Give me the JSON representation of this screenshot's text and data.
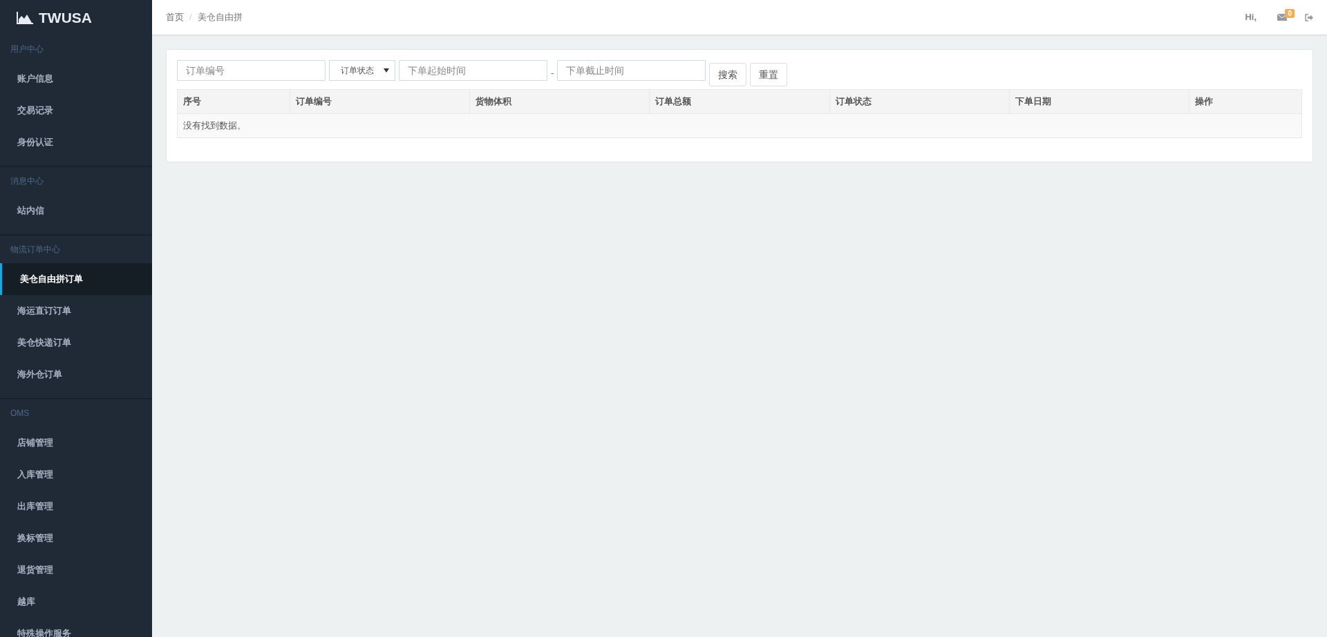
{
  "brand": {
    "name": "TWUSA"
  },
  "sidebar": {
    "sections": [
      {
        "title": "用户中心",
        "items": [
          {
            "label": "账户信息",
            "selected": false
          },
          {
            "label": "交易记录",
            "selected": false
          },
          {
            "label": "身份认证",
            "selected": false
          }
        ]
      },
      {
        "title": "消息中心",
        "items": [
          {
            "label": "站内信",
            "selected": false
          }
        ]
      },
      {
        "title": "物流订单中心",
        "items": [
          {
            "label": "美仓自由拼订单",
            "selected": true
          },
          {
            "label": "海运直订订单",
            "selected": false
          },
          {
            "label": "美仓快递订单",
            "selected": false
          },
          {
            "label": "海外仓订单",
            "selected": false
          }
        ]
      },
      {
        "title": "OMS",
        "items": [
          {
            "label": "店铺管理",
            "selected": false
          },
          {
            "label": "入库管理",
            "selected": false
          },
          {
            "label": "出库管理",
            "selected": false
          },
          {
            "label": "换标管理",
            "selected": false
          },
          {
            "label": "退货管理",
            "selected": false
          },
          {
            "label": "越库",
            "selected": false
          },
          {
            "label": "特殊操作服务",
            "selected": false
          }
        ]
      }
    ]
  },
  "breadcrumb": {
    "separator": "/",
    "items": [
      "首页",
      "美仓自由拼"
    ]
  },
  "header": {
    "greeting": "Hi,",
    "mail_count": "0"
  },
  "filters": {
    "order_no": {
      "placeholder": "订单编号"
    },
    "status": {
      "value": "订单状态"
    },
    "start_time": {
      "placeholder": "下单起始时间"
    },
    "range_separator": "-",
    "end_time": {
      "placeholder": "下单截止时间"
    },
    "buttons": [
      "搜索",
      "重置"
    ]
  },
  "table": {
    "columns": [
      "序号",
      "订单编号",
      "货物体积",
      "订单总额",
      "订单状态",
      "下单日期",
      "操作"
    ],
    "empty_text": "没有找到数据。"
  }
}
